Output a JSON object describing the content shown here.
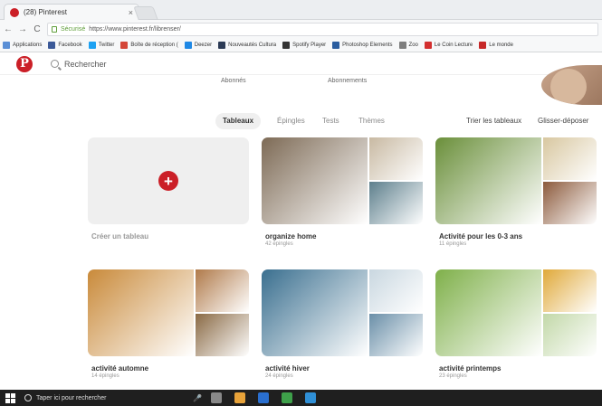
{
  "browser": {
    "tab_title": "(28) Pinterest",
    "tab_close": "×",
    "nav": {
      "back": "←",
      "forward": "→",
      "reload": "C"
    },
    "secure_label": "Sécurisé",
    "url": "https://www.pinterest.fr/librenser/",
    "bookmarks": [
      {
        "label": "Applications",
        "color": "#5a8fd6"
      },
      {
        "label": "Facebook",
        "color": "#3b5998"
      },
      {
        "label": "Twitter",
        "color": "#1da1f2"
      },
      {
        "label": "Boîte de réception (",
        "color": "#d44638"
      },
      {
        "label": "Deezer",
        "color": "#1e88e5"
      },
      {
        "label": "Nouveautés Cultura",
        "color": "#2b3a55"
      },
      {
        "label": "Spotify Player",
        "color": "#333333"
      },
      {
        "label": "Photoshop Elements",
        "color": "#2a5d9f"
      },
      {
        "label": "Zoo",
        "color": "#7d7d7d"
      },
      {
        "label": "Le Coin Lecture",
        "color": "#d32f2f"
      },
      {
        "label": "Le monde",
        "color": "#c62828"
      }
    ]
  },
  "pinterest": {
    "logo_letter": "P",
    "search_placeholder": "Rechercher",
    "stats": [
      {
        "label": "Abonnés"
      },
      {
        "label": "Abonnements"
      }
    ],
    "tabs": [
      "Tableaux",
      "Épingles",
      "Tests",
      "Thèmes"
    ],
    "active_tab": "Tableaux",
    "right_actions": [
      "Trier les tableaux",
      "Glisser-déposer"
    ],
    "create_board": {
      "plus": "+",
      "label": "Créer un tableau"
    },
    "boards": [
      {
        "title": "organize home",
        "count": "42 épingles",
        "colors": [
          "#7d6a55",
          "#c8b9a2",
          "#5d7f8c"
        ]
      },
      {
        "title": "Activité pour les 0-3 ans",
        "count": "11 épingles",
        "colors": [
          "#6a8f3a",
          "#d8c7a0",
          "#8c5a3c"
        ]
      },
      {
        "title": "activité automne",
        "count": "14 épingles",
        "colors": [
          "#c98a3a",
          "#b07a4a",
          "#8a6a45"
        ]
      },
      {
        "title": "activité hiver",
        "count": "24 épingles",
        "colors": [
          "#3a6f8f",
          "#c9d7e0",
          "#6a8fa8"
        ]
      },
      {
        "title": "activité printemps",
        "count": "23 épingles",
        "colors": [
          "#7fb04a",
          "#e0a93a",
          "#c2d8a8"
        ]
      }
    ]
  },
  "taskbar": {
    "search_text": "Taper ici pour rechercher",
    "apps": [
      "#888888",
      "#e8a33a",
      "#2a6fcf",
      "#3ea04a",
      "#2f8fd6"
    ]
  }
}
